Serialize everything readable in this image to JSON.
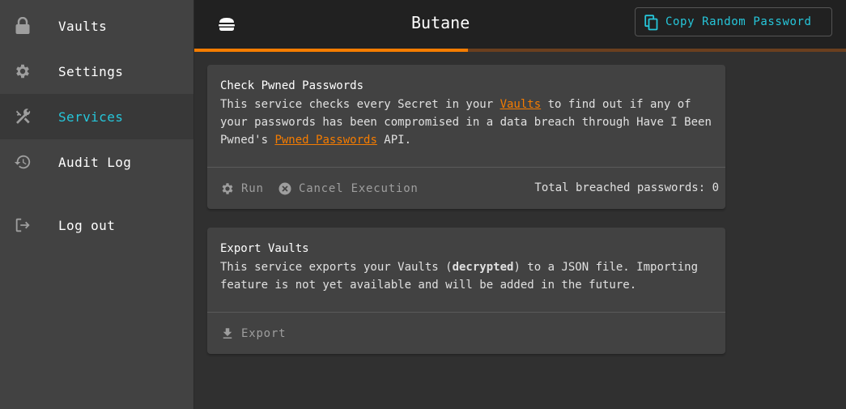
{
  "app": {
    "title": "Butane",
    "accent": "#f57c00",
    "active_color": "#26c6da"
  },
  "sidebar": {
    "items": [
      {
        "label": "Vaults",
        "icon": "lock-icon"
      },
      {
        "label": "Settings",
        "icon": "gear-icon"
      },
      {
        "label": "Services",
        "icon": "tools-icon",
        "active": true
      },
      {
        "label": "Audit Log",
        "icon": "history-icon"
      },
      {
        "label": "Log out",
        "icon": "logout-icon"
      }
    ]
  },
  "toolbar": {
    "menu_icon": "burger-menu-icon",
    "copy_button_label": "Copy Random Password",
    "copy_icon": "copy-icon"
  },
  "progress": {
    "value": 0.42
  },
  "services": {
    "pwned": {
      "title": "Check Pwned Passwords",
      "text_1": "This service checks every Secret in your ",
      "link_vaults": "Vaults",
      "text_2": " to find out if any of your passwords has been compromised in a data breach through Have I Been Pwned's ",
      "link_pwned": "Pwned Passwords",
      "text_3": " API.",
      "run_label": "Run",
      "cancel_label": "Cancel Execution",
      "stat_label": "Total breached passwords: 0"
    },
    "export": {
      "title": "Export Vaults",
      "text_1": "This service exports your Vaults (",
      "text_bold": "decrypted",
      "text_2": ") to a JSON file. Importing feature is not yet available and will be added in the future.",
      "export_label": "Export"
    }
  }
}
